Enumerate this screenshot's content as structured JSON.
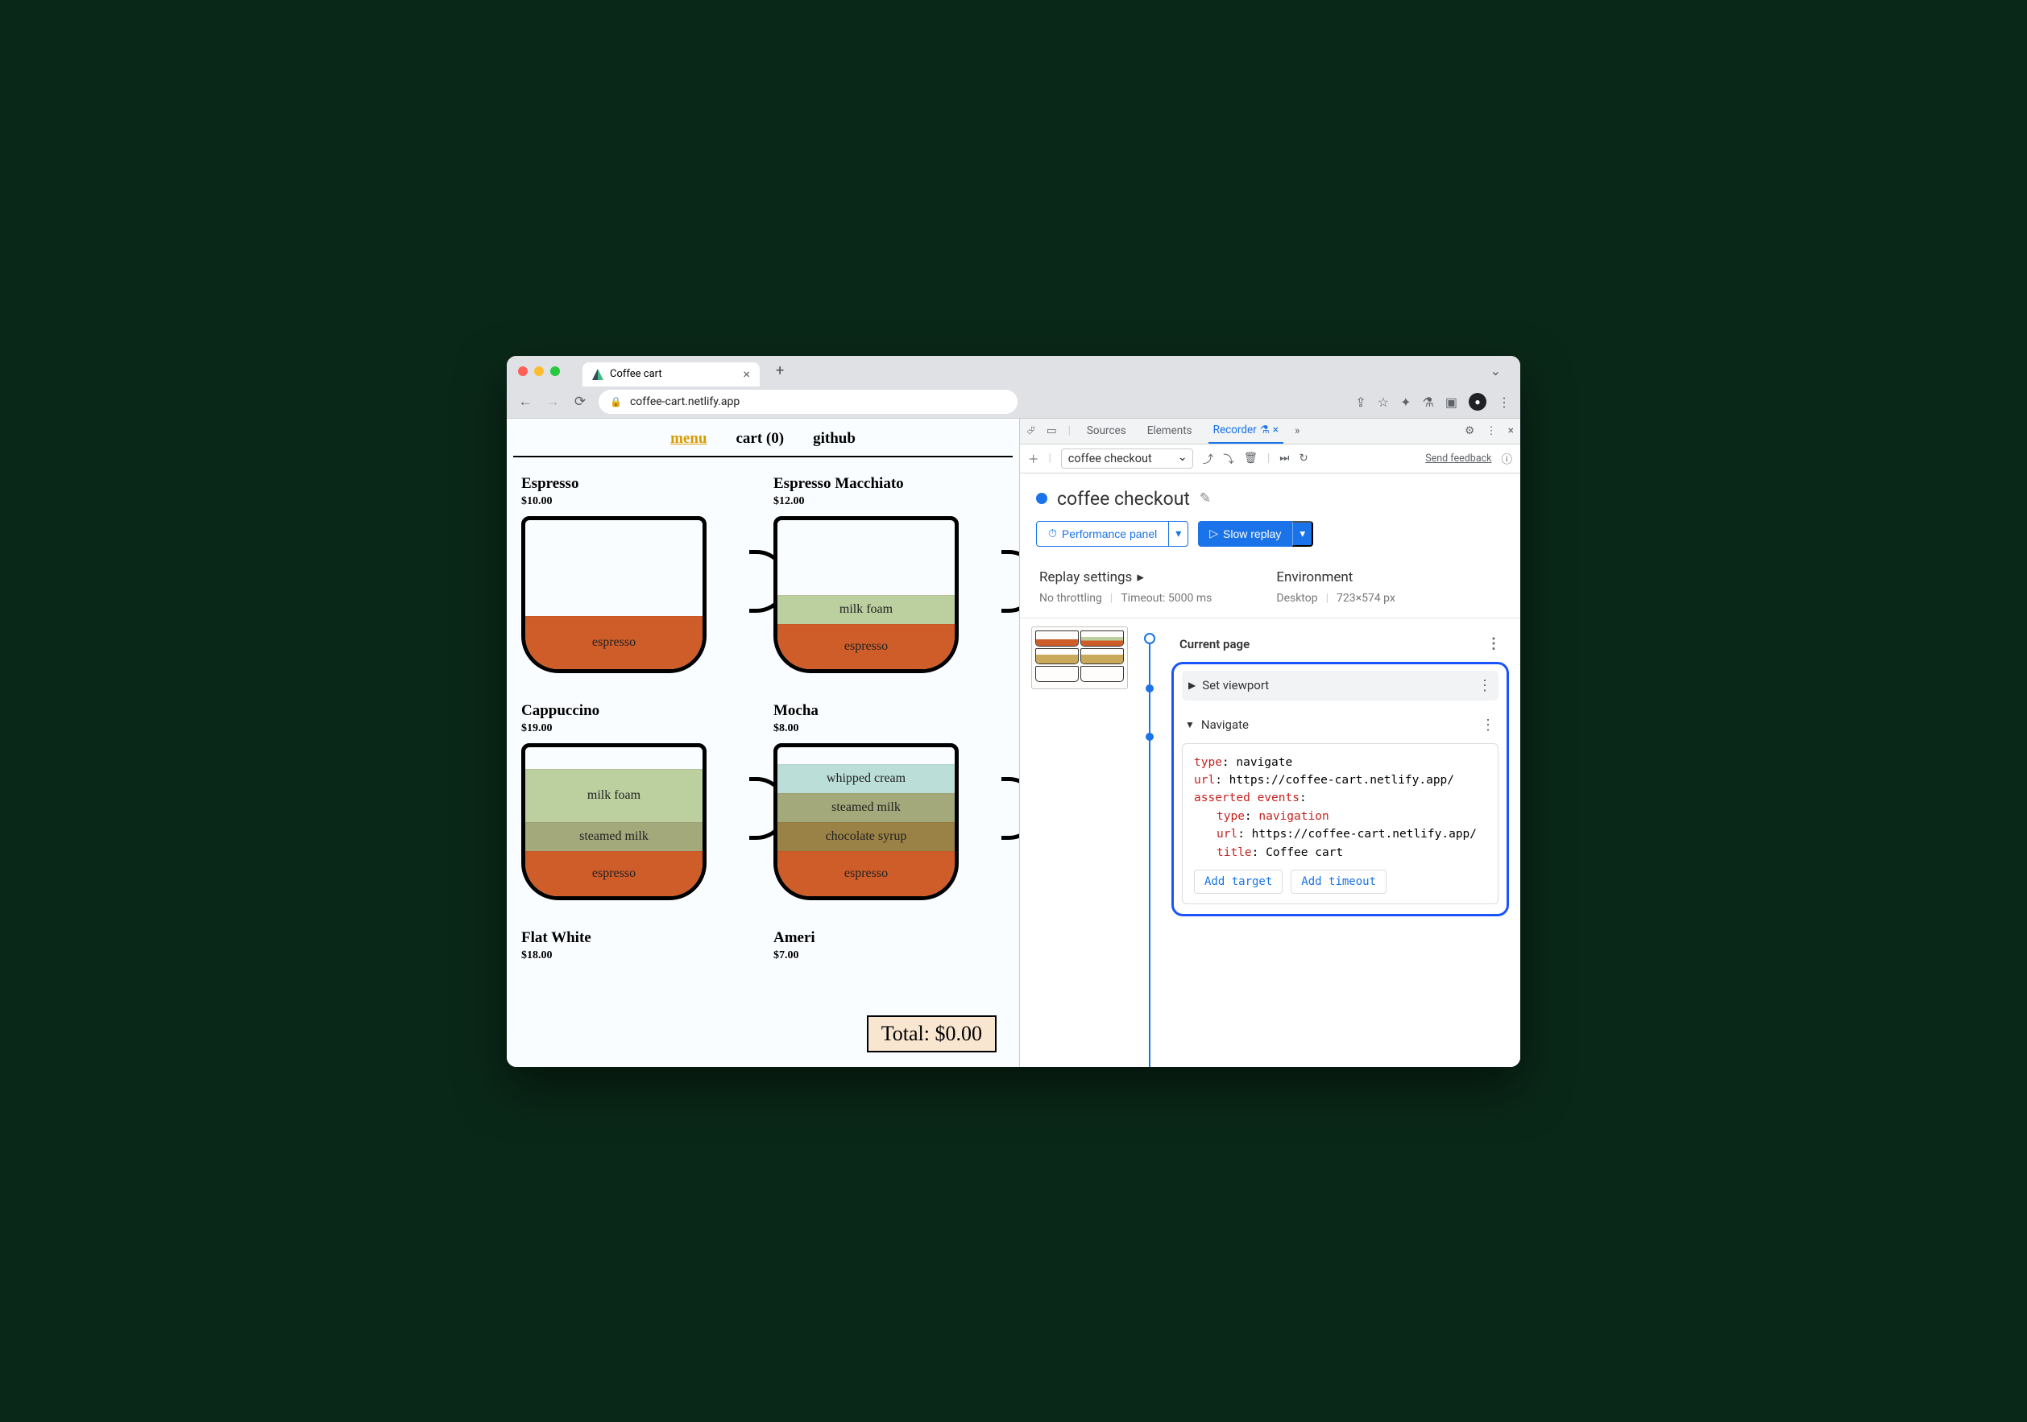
{
  "window": {
    "tab_title": "Coffee cart",
    "url": "coffee-cart.netlify.app"
  },
  "site_nav": {
    "menu": "menu",
    "cart": "cart (0)",
    "github": "github"
  },
  "products": [
    {
      "name": "Espresso",
      "price": "$10.00",
      "layers": [
        [
          "espresso",
          "l-espresso"
        ]
      ],
      "tall_espresso": true
    },
    {
      "name": "Espresso Macchiato",
      "price": "$12.00",
      "layers": [
        [
          "milk foam",
          "l-milkfoam"
        ],
        [
          "espresso",
          "l-espresso"
        ]
      ]
    },
    {
      "name": "Cappuccino",
      "price": "$19.00",
      "layers": [
        [
          "milk foam",
          "l-milkfoam"
        ],
        [
          "steamed milk",
          "l-steamed"
        ],
        [
          "espresso",
          "l-espresso"
        ]
      ],
      "foam_big": true
    },
    {
      "name": "Mocha",
      "price": "$8.00",
      "layers": [
        [
          "whipped cream",
          "l-whip"
        ],
        [
          "steamed milk",
          "l-steamed"
        ],
        [
          "chocolate syrup",
          "l-choc"
        ],
        [
          "espresso",
          "l-espresso"
        ]
      ]
    },
    {
      "name": "Flat White",
      "price": "$18.00",
      "layers": []
    },
    {
      "name": "Ameri",
      "price": "$7.00",
      "layers": []
    }
  ],
  "total_label": "Total: $0.00",
  "devtools": {
    "tabs": {
      "sources": "Sources",
      "elements": "Elements",
      "recorder": "Recorder"
    },
    "recording_select": "coffee checkout",
    "feedback": "Send feedback",
    "name": "coffee checkout",
    "perf_btn": "Performance panel",
    "replay_btn": "Slow replay",
    "settings": {
      "replay_h": "Replay settings",
      "replay_a": "No throttling",
      "replay_b": "Timeout: 5000 ms",
      "env_h": "Environment",
      "env_a": "Desktop",
      "env_b": "723×574 px"
    },
    "timeline": {
      "current_page": "Current page",
      "set_viewport": "Set viewport",
      "navigate": "Navigate",
      "code": {
        "l1k": "type",
        "l1v": ": navigate",
        "l2k": "url",
        "l2v": ": https://coffee-cart.netlify.app/",
        "l3k": "asserted events",
        "l3v": ":",
        "l4k": "type",
        "l4v": ": ",
        "l4r": "navigation",
        "l5k": "url",
        "l5v": ": https://coffee-cart.netlify.app/",
        "l6k": "title",
        "l6v": ": Coffee cart"
      },
      "add_target": "Add target",
      "add_timeout": "Add timeout"
    }
  }
}
